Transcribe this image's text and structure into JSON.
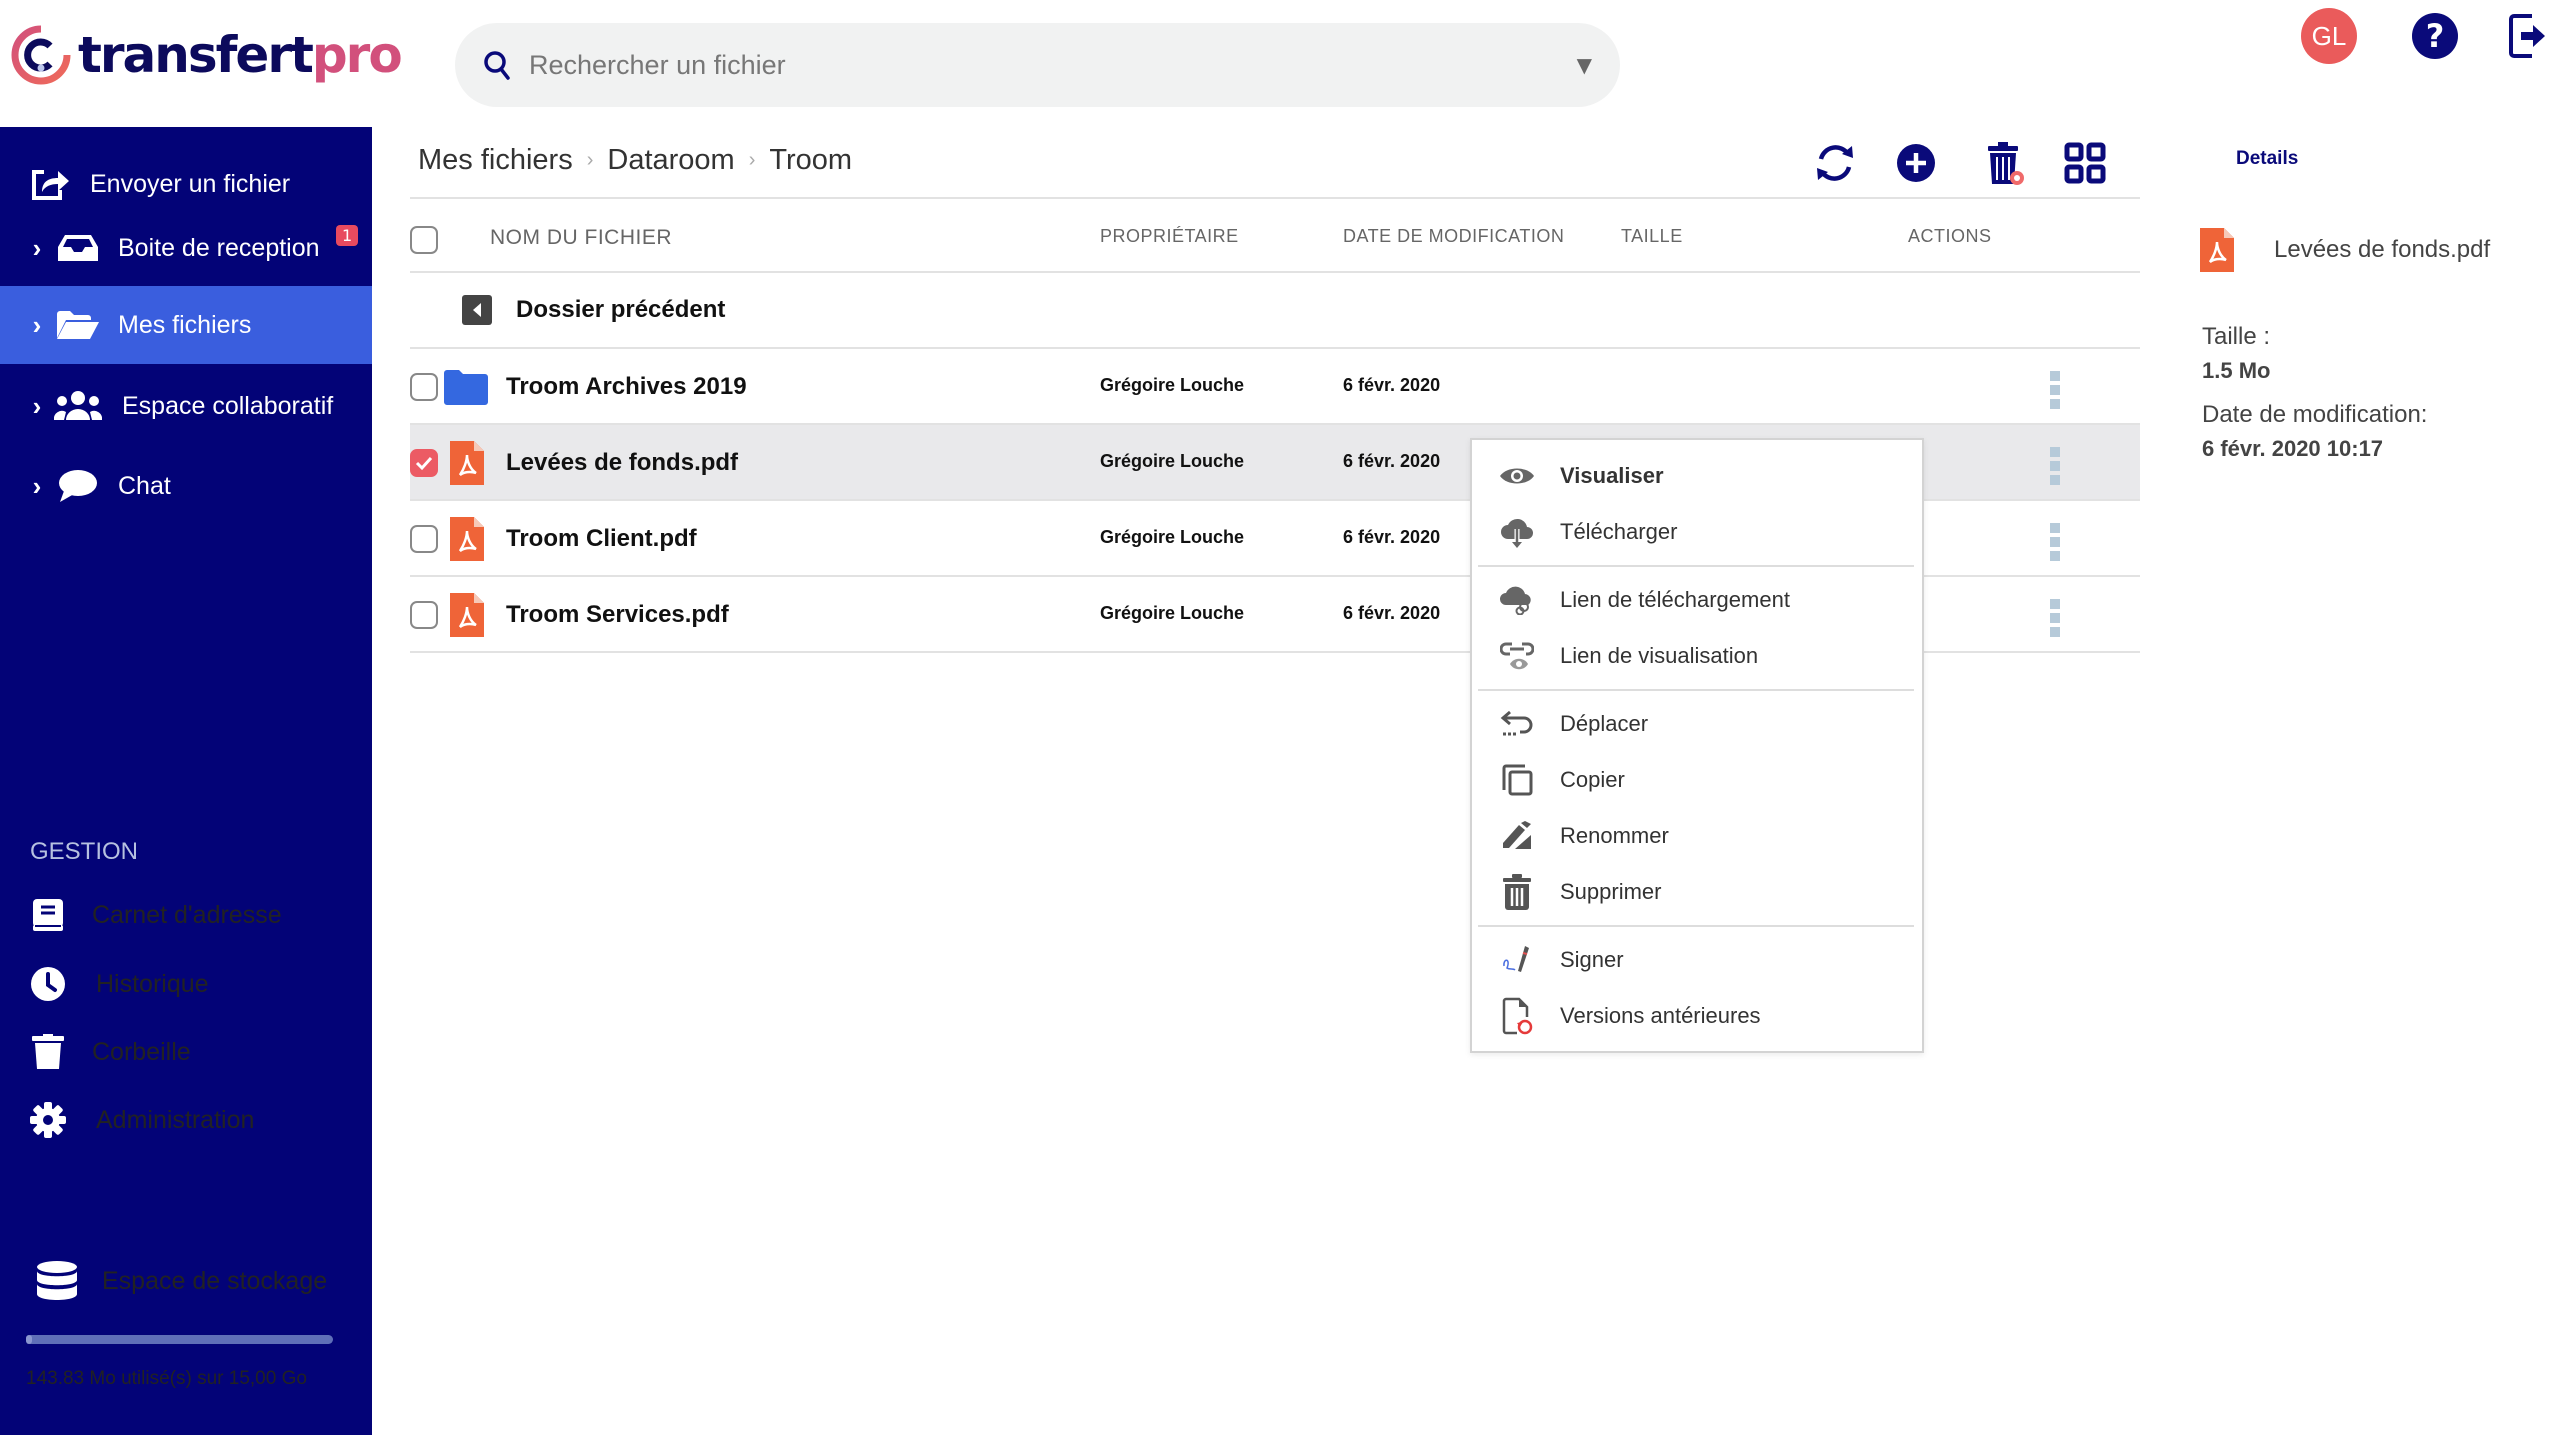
{
  "brand": {
    "name_main": "transfert",
    "name_accent": "pro",
    "accent_color": "#d2507c",
    "primary_color": "#030377"
  },
  "search": {
    "placeholder": "Rechercher un fichier",
    "icon": "search-icon"
  },
  "topbar": {
    "avatar_initials": "GL",
    "help_icon": "help-icon",
    "logout_icon": "logout-icon"
  },
  "sidebar": {
    "items": [
      {
        "label": "Envoyer un fichier",
        "icon": "share-icon",
        "expandable": false
      },
      {
        "label": "Boite de reception",
        "icon": "inbox-icon",
        "expandable": true,
        "badge": "1"
      },
      {
        "label": "Mes fichiers",
        "icon": "folder-open-icon",
        "expandable": true,
        "active": true
      },
      {
        "label": "Espace collaboratif",
        "icon": "users-icon",
        "expandable": true
      },
      {
        "label": "Chat",
        "icon": "chat-icon",
        "expandable": true
      }
    ],
    "section_title": "GESTION",
    "management": [
      {
        "label": "Carnet d'adresse",
        "icon": "address-book-icon"
      },
      {
        "label": "Historique",
        "icon": "clock-icon"
      },
      {
        "label": "Corbeille",
        "icon": "trash-icon"
      },
      {
        "label": "Administration",
        "icon": "gear-icon"
      }
    ],
    "storage": {
      "label": "Espace de stockage",
      "usage_text": "143.83 Mo utilisé(s) sur 15,00 Go",
      "used_fraction": 0.0094
    }
  },
  "breadcrumb": [
    "Mes fichiers",
    "Dataroom",
    "Troom"
  ],
  "toolbar": {
    "refresh": "refresh-icon",
    "add": "add-icon",
    "trash": "trash-restore-icon",
    "grid": "grid-view-icon"
  },
  "table": {
    "columns": [
      "NOM DU FICHIER",
      "PROPRIÉTAIRE",
      "DATE DE MODIFICATION",
      "TAILLE",
      "ACTIONS"
    ],
    "back_label": "Dossier précédent",
    "rows": [
      {
        "name": "Troom Archives 2019",
        "type": "folder",
        "owner": "Grégoire Louche",
        "date": "6 févr. 2020",
        "size": "",
        "checked": false
      },
      {
        "name": "Levées de fonds.pdf",
        "type": "pdf",
        "owner": "Grégoire Louche",
        "date": "6 févr. 2020",
        "size": "",
        "checked": true
      },
      {
        "name": "Troom Client.pdf",
        "type": "pdf",
        "owner": "Grégoire Louche",
        "date": "6 févr. 2020",
        "size": "",
        "checked": false
      },
      {
        "name": "Troom Services.pdf",
        "type": "pdf",
        "owner": "Grégoire Louche",
        "date": "6 févr. 2020",
        "size": "",
        "checked": false
      }
    ]
  },
  "context_menu": {
    "items": [
      {
        "label": "Visualiser",
        "icon": "eye-icon"
      },
      {
        "label": "Télécharger",
        "icon": "cloud-download-icon"
      },
      {
        "label": "Lien de téléchargement",
        "icon": "cloud-link-icon"
      },
      {
        "label": "Lien de visualisation",
        "icon": "link-eye-icon"
      },
      {
        "label": "Déplacer",
        "icon": "move-icon"
      },
      {
        "label": "Copier",
        "icon": "copy-icon"
      },
      {
        "label": "Renommer",
        "icon": "rename-icon"
      },
      {
        "label": "Supprimer",
        "icon": "trash-icon"
      },
      {
        "label": "Signer",
        "icon": "sign-icon"
      },
      {
        "label": "Versions antérieures",
        "icon": "file-history-icon"
      }
    ]
  },
  "details": {
    "title": "Details",
    "file_name": "Levées de fonds.pdf",
    "size_label": "Taille :",
    "size_value": "1.5 Mo",
    "date_label": "Date de modification:",
    "date_value": "6 févr. 2020 10:17"
  }
}
